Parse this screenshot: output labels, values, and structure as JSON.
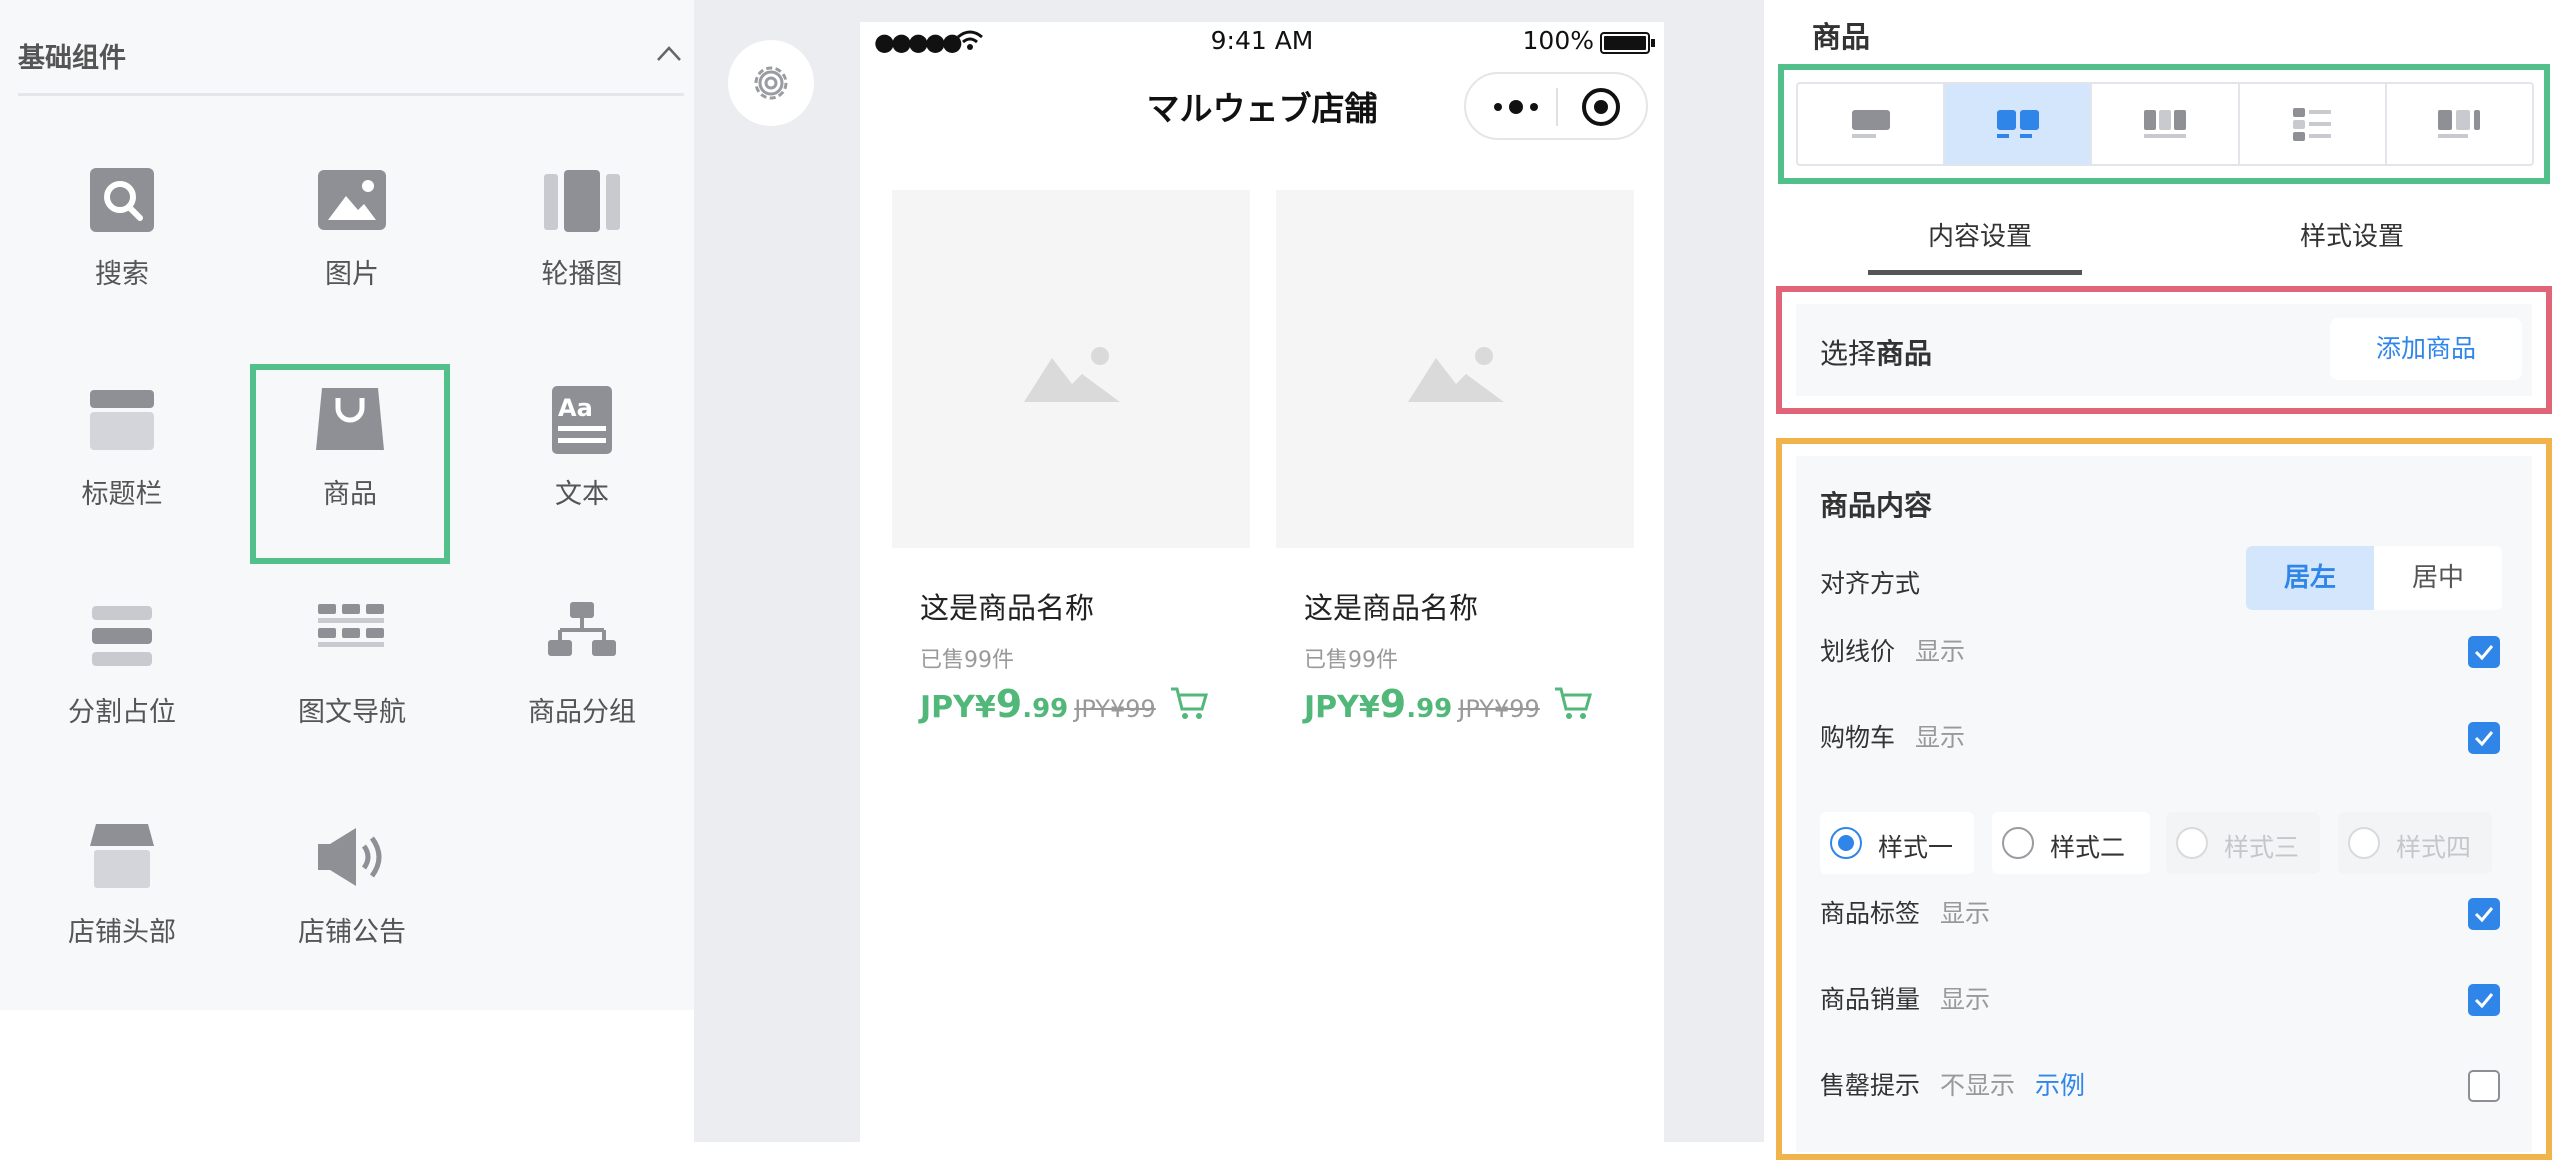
{
  "left_panel": {
    "title": "基础组件",
    "components": [
      {
        "label": "搜索",
        "icon": "search-icon"
      },
      {
        "label": "图片",
        "icon": "image-icon"
      },
      {
        "label": "轮播图",
        "icon": "carousel-icon"
      },
      {
        "label": "标题栏",
        "icon": "title-bar-icon"
      },
      {
        "label": "商品",
        "icon": "shopping-bag-icon"
      },
      {
        "label": "文本",
        "icon": "text-icon"
      },
      {
        "label": "分割占位",
        "icon": "divider-icon"
      },
      {
        "label": "图文导航",
        "icon": "nav-grid-icon"
      },
      {
        "label": "商品分组",
        "icon": "hierarchy-icon"
      },
      {
        "label": "店铺头部",
        "icon": "store-icon"
      },
      {
        "label": "店铺公告",
        "icon": "megaphone-icon"
      }
    ]
  },
  "phone": {
    "signal": "●●●●●",
    "time": "9:41 AM",
    "battery": "100%",
    "nav_title": "マルウェブ店舗",
    "products": [
      {
        "name": "这是商品名称",
        "sold": "已售99件",
        "currency": "JPY¥",
        "price_int": "9",
        "price_dec": ".99",
        "original": "JPY¥99"
      },
      {
        "name": "这是商品名称",
        "sold": "已售99件",
        "currency": "JPY¥",
        "price_int": "9",
        "price_dec": ".99",
        "original": "JPY¥99"
      }
    ]
  },
  "right_panel": {
    "title": "商品",
    "tabs": {
      "content": "内容设置",
      "style": "样式设置"
    },
    "select": {
      "prefix": "选择",
      "bold": "商品",
      "add_button": "添加商品"
    },
    "content": {
      "title": "商品内容",
      "align_label": "对齐方式",
      "align_options": [
        "居左",
        "居中"
      ],
      "strike_label": "划线价",
      "strike_hint": "显示",
      "cart_label": "购物车",
      "cart_hint": "显示",
      "cart_styles": [
        "样式一",
        "样式二",
        "样式三",
        "样式四"
      ],
      "tag_label": "商品标签",
      "tag_hint": "显示",
      "sales_label": "商品销量",
      "sales_hint": "显示",
      "soldout_label": "售罄提示",
      "soldout_hint": "不显示",
      "soldout_link": "示例"
    }
  },
  "colors": {
    "accent_blue": "#2f86e8",
    "price_green": "#52b87a",
    "highlight_green": "#52c08a",
    "highlight_red": "#e06578",
    "highlight_orange": "#f1b44c"
  }
}
